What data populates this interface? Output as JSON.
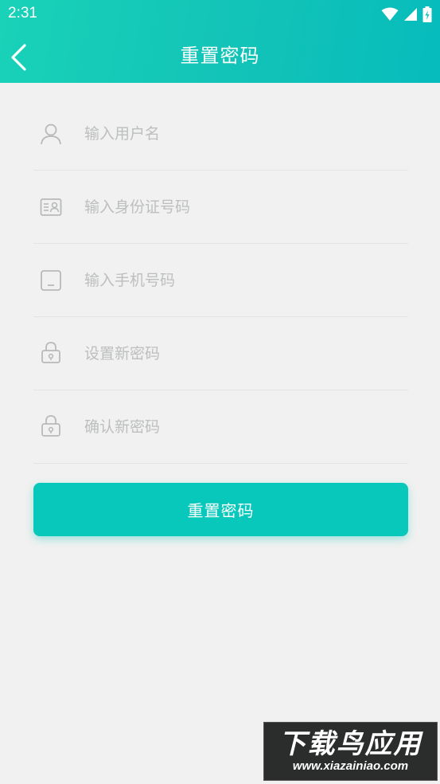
{
  "status_bar": {
    "time": "2:31"
  },
  "header": {
    "title": "重置密码",
    "back_icon": "chevron-left-icon"
  },
  "form": {
    "fields": [
      {
        "icon": "user-icon",
        "placeholder": "输入用户名",
        "value": ""
      },
      {
        "icon": "id-card-icon",
        "placeholder": "输入身份证号码",
        "value": ""
      },
      {
        "icon": "phone-icon",
        "placeholder": "输入手机号码",
        "value": ""
      },
      {
        "icon": "lock-icon",
        "placeholder": "设置新密码",
        "value": ""
      },
      {
        "icon": "lock-icon",
        "placeholder": "确认新密码",
        "value": ""
      }
    ]
  },
  "submit": {
    "label": "重置密码"
  },
  "watermark": {
    "main": "下载鸟应用",
    "sub": "www.xiazainiao.com"
  },
  "colors": {
    "accent": "#08c8bb",
    "header_start": "#19d2b8",
    "header_end": "#06bcbc",
    "background": "#f0f1f0"
  }
}
